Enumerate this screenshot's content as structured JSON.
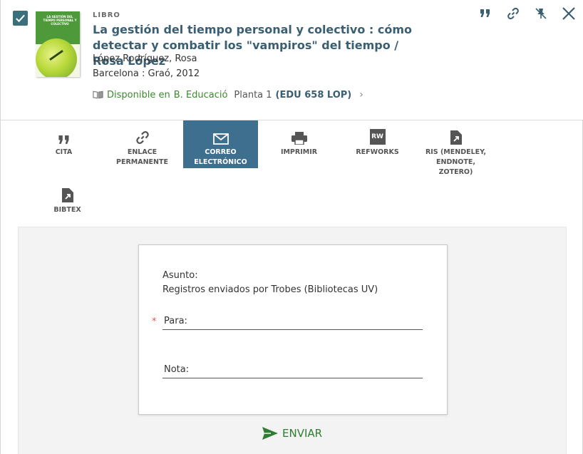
{
  "record": {
    "type": "LIBRO",
    "title": "La gestión del tiempo personal y colectivo : cómo detectar y combatir los \"vampiros\" del tiempo / Rosa López",
    "author": "López Rodríguez, Rosa",
    "publication": "Barcelona : Graó, 2012",
    "cover": {
      "title": "LA GESTIÓN DEL TIEMPO PERSONAL Y COLECTIVO"
    },
    "availability": {
      "status": "Disponible en",
      "library": "B. Educació",
      "location": "Planta 1",
      "call_number": "(EDU 658 LOP)"
    },
    "colors": {
      "title": "#3a5f72",
      "available": "#3b8a2e",
      "checkbox": "#3a6f7c"
    }
  },
  "top_actions": [
    {
      "icon": "quote-icon"
    },
    {
      "icon": "link-icon"
    },
    {
      "icon": "pin-icon"
    },
    {
      "icon": "close-icon"
    }
  ],
  "tabs": [
    {
      "label": "CITA",
      "icon": "quote-icon"
    },
    {
      "label": "ENLACE PERMANENTE",
      "icon": "link-icon"
    },
    {
      "label": "CORREO ELECTRÓNICO",
      "icon": "envelope-icon",
      "active": true
    },
    {
      "label": "IMPRIMIR",
      "icon": "printer-icon"
    },
    {
      "label": "REFWORKS",
      "icon": "refworks-icon",
      "icon_text": "RW"
    },
    {
      "label": "RIS (MENDELEY, ENDNOTE, ZOTERO)",
      "icon": "export-icon"
    },
    {
      "label": "BIBTEX",
      "icon": "export-icon"
    }
  ],
  "email_form": {
    "subject_label": "Asunto:",
    "subject_value": "Registros enviados por Trobes (Bibliotecas UV)",
    "to_label": "Para:",
    "to_required": "*",
    "note_label": "Nota:",
    "send_label": "ENVIAR",
    "accent": "#2e7d32"
  }
}
